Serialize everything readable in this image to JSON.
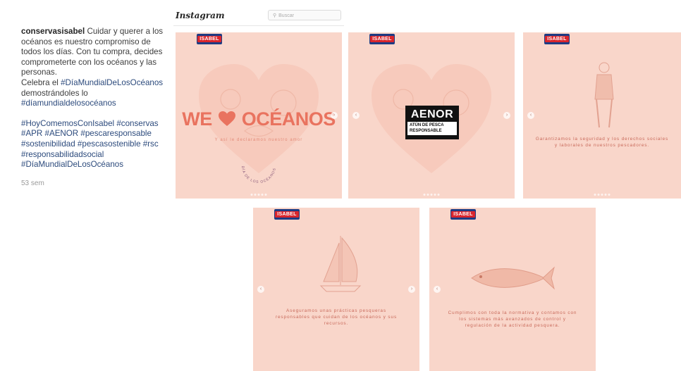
{
  "caption": {
    "username": "conservasisabel",
    "text1": " Cuidar y querer a los océanos es nuestro compromiso de todos los días. Con tu compra, decides comprometerte con los océanos y las personas.",
    "celebra": "Celebra el ",
    "tag_dia": "#DíaMundialDeLosOcéanos",
    "demostrando": " demostrándoles lo ",
    "tag_dia_lower": "#díamundialdelosocéanos",
    "hashtags": "#HoyComemosConIsabel #conservas #APR #AENOR #pescaresponsable #sostenibilidad #pescasostenible #rsc #responsabilidadsocial #DíaMundialDeLosOcéanos",
    "time": "53 sem"
  },
  "header": {
    "logo": "Instagram",
    "search_placeholder": "Buscar",
    "search_icon": "search-icon"
  },
  "brand": "ISABEL",
  "slides": {
    "s1": {
      "we": "WE",
      "oceanos": "OCÉANOS",
      "sub": "Y así le declaramos nuestro amor",
      "circle": "DÍA DE LOS OCÉANOS"
    },
    "s2": {
      "aenor": "AENOR",
      "label_line1": "ATÚN DE PESCA",
      "label_line2": "RESPONSABLE"
    },
    "s3": {
      "text": "Garantizamos la seguridad y los derechos sociales y laborales de nuestros pescadores."
    },
    "s4": {
      "text": "Aseguramos unas prácticas pesqueras responsables que cuidan de los océanos y sus recursos."
    },
    "s5": {
      "text": "Cumplimos con toda la normativa y contamos con los sistemas más avanzados de control y regulación de la actividad pesquera."
    }
  },
  "colors": {
    "slide_bg": "#f9d6ca",
    "accent": "#e9735f",
    "brand_blue": "#1d3c84",
    "brand_red": "#d9262d"
  }
}
